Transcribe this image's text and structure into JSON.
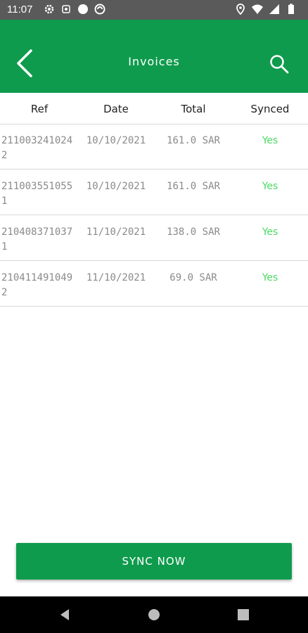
{
  "status_bar": {
    "time": "11:07",
    "left_icons": [
      "gear-icon",
      "notification-icon",
      "circle-icon",
      "sync-icon"
    ],
    "right_icons": [
      "location-icon",
      "wifi-icon",
      "signal-icon",
      "battery-icon"
    ]
  },
  "app_bar": {
    "title": "Invoices",
    "back_icon": "back-arrow-icon",
    "search_icon": "search-icon",
    "color": "#0f9b4d"
  },
  "table": {
    "headers": [
      "Ref",
      "Date",
      "Total",
      "Synced"
    ],
    "rows": [
      {
        "ref": "2110032410242",
        "date": "10/10/2021",
        "total": "161.0 SAR",
        "synced": "Yes"
      },
      {
        "ref": "2110035510551",
        "date": "10/10/2021",
        "total": "161.0 SAR",
        "synced": "Yes"
      },
      {
        "ref": "2104083710371",
        "date": "11/10/2021",
        "total": "138.0 SAR",
        "synced": "Yes"
      },
      {
        "ref": "2104114910492",
        "date": "11/10/2021",
        "total": "69.0 SAR",
        "synced": "Yes"
      }
    ],
    "synced_color": "#4cd964"
  },
  "sync_button": {
    "label": "SYNC NOW"
  },
  "nav_bar": {
    "buttons": [
      "back-triangle-icon",
      "home-circle-icon",
      "recents-square-icon"
    ]
  }
}
